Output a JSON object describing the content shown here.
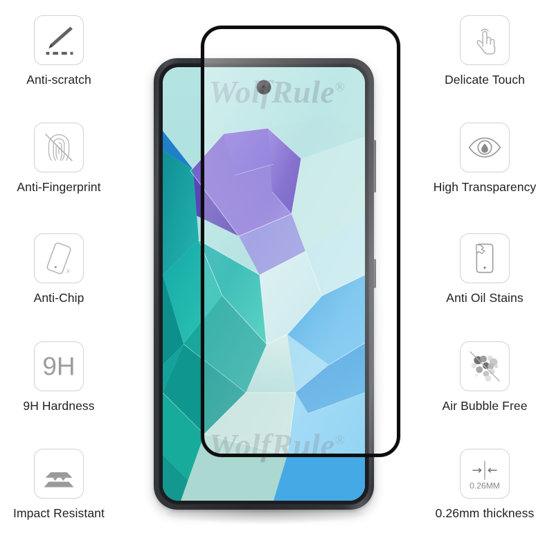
{
  "product": {
    "brand_watermark": "WolfRule",
    "watermark_mark": "®"
  },
  "left_features": [
    {
      "key": "anti-scratch",
      "label": "Anti-scratch",
      "icon": "knife-scratch-icon"
    },
    {
      "key": "anti-fingerprint",
      "label": "Anti-Fingerprint",
      "icon": "fingerprint-crossed-icon"
    },
    {
      "key": "anti-chip",
      "label": "Anti-Chip",
      "icon": "tilted-phone-icon"
    },
    {
      "key": "9h-hardness",
      "label": "9H Hardness",
      "icon": "hardness-9h-icon",
      "icon_text": "9H"
    },
    {
      "key": "impact-resistant",
      "label": "Impact Resistant",
      "icon": "layered-impact-icon"
    }
  ],
  "right_features": [
    {
      "key": "delicate-touch",
      "label": "Delicate Touch",
      "icon": "touch-hand-icon"
    },
    {
      "key": "high-transparency",
      "label": "High Transparency",
      "icon": "eye-icon"
    },
    {
      "key": "anti-oil-stains",
      "label": "Anti Oil Stains",
      "icon": "phone-oil-stain-icon"
    },
    {
      "key": "air-bubble-free",
      "label": "Air Bubble Free",
      "icon": "bubbles-crossed-icon"
    },
    {
      "key": "thickness",
      "label": "0.26mm thickness",
      "icon": "thickness-caliper-icon",
      "icon_text": "0.26MM"
    }
  ],
  "colors": {
    "label_text": "#231f20",
    "icon_border": "#d2d2d2",
    "icon_gray": "#7f7f7f",
    "icon_light_gray": "#9a9a9a",
    "glass_border": "#0d0d0d",
    "phone_body": "#2b2d30",
    "screen_mint": "#a9dfe0",
    "screen_purple": "#7b62d6",
    "screen_teal": "#17a7a4",
    "screen_blue": "#2f9de0",
    "watermark": "#5f5f73"
  }
}
